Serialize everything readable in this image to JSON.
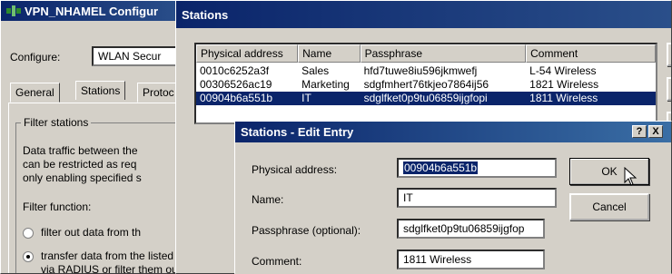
{
  "back_window": {
    "title": "VPN_NHAMEL Configur",
    "configure_label": "Configure:",
    "configure_value": "WLAN Secur",
    "tabs": [
      "General",
      "Stations",
      "Protoc"
    ],
    "group_title": "Filter stations",
    "description_lines": [
      "Data traffic between the",
      "can be restricted as req",
      "only enabling specified s"
    ],
    "filter_function_label": "Filter function:",
    "option_1": "filter out data from th",
    "option_2_line1": "transfer data from the listed stat",
    "option_2_line2": "via RADIUS or filter them out"
  },
  "stations_window": {
    "title": "Stations",
    "columns": [
      "Physical address",
      "Name",
      "Passphrase",
      "Comment"
    ],
    "rows": [
      {
        "address": "0010c6252a3f",
        "name": "Sales",
        "passphrase": "hfd7tuwe8iu596jkmwefj",
        "comment": "L-54 Wireless"
      },
      {
        "address": "00306526ac19",
        "name": "Marketing",
        "passphrase": "sdgfmhert76tkjeo7864ij56",
        "comment": "1821 Wireless"
      },
      {
        "address": "00904b6a551b",
        "name": "IT",
        "passphrase": "sdglfket0p9tu06859ijgfopi",
        "comment": "1811 Wireless"
      }
    ]
  },
  "edit_dialog": {
    "title": "Stations - Edit Entry",
    "help_btn": "?",
    "close_btn": "X",
    "physical_address_label": "Physical address:",
    "physical_address_value": "00904b6a551b",
    "name_label": "Name:",
    "name_value": "IT",
    "passphrase_label": "Passphrase (optional):",
    "passphrase_value": "sdglfket0p9tu06859ijgfop",
    "comment_label": "Comment:",
    "comment_value": "1811 Wireless",
    "ok_label": "OK",
    "cancel_label": "Cancel"
  },
  "colors": {
    "titlebar": "#0a246a",
    "window_bg": "#d4d0c8",
    "selection": "#0a246a"
  }
}
